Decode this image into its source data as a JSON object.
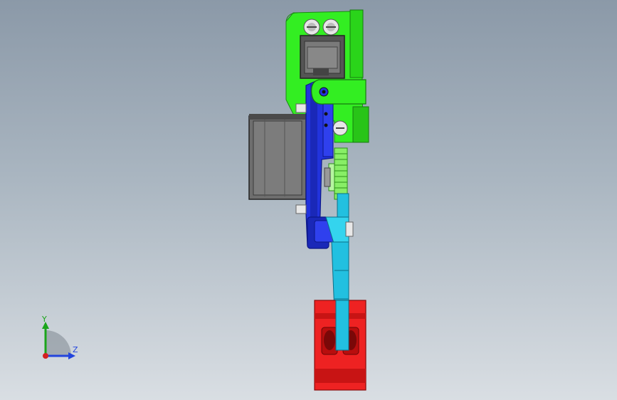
{
  "triad": {
    "y_label": "Y",
    "z_label": "Z",
    "colors": {
      "y": "#1aa51a",
      "z": "#2244dd",
      "x": "#d42020",
      "floor": "#7e8790"
    }
  },
  "model_colors": {
    "mount_bracket": "#33ee22",
    "motor_body": "#6e6e6e",
    "link_main": "#2233dd",
    "gear": "#88ee66",
    "link_lower": "#22c0e0",
    "end_block": "#ee2222",
    "screw": "#e0e0e0"
  }
}
